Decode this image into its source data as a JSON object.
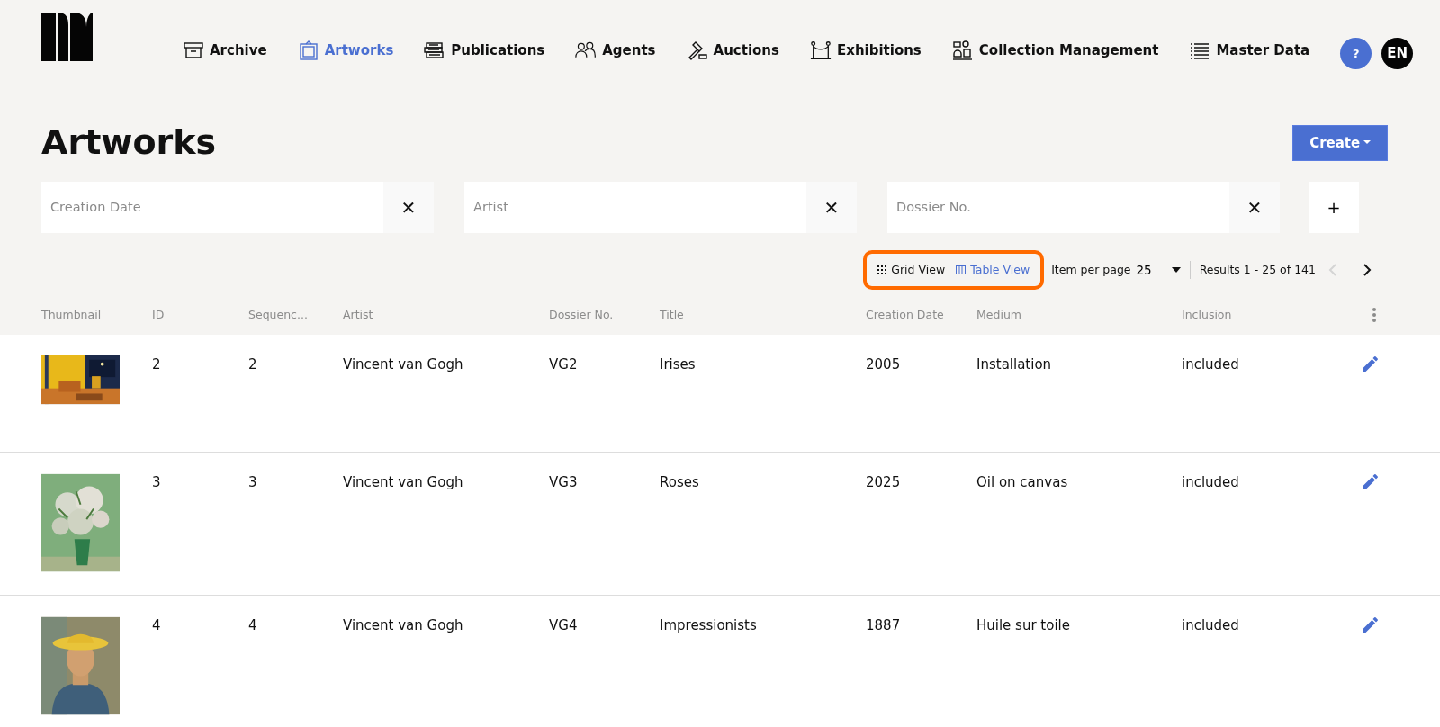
{
  "nav": {
    "items": [
      {
        "label": "Archive",
        "selected": false
      },
      {
        "label": "Artworks",
        "selected": true
      },
      {
        "label": "Publications",
        "selected": false
      },
      {
        "label": "Agents",
        "selected": false
      },
      {
        "label": "Auctions",
        "selected": false
      },
      {
        "label": "Exhibitions",
        "selected": false
      },
      {
        "label": "Collection Management",
        "selected": false
      },
      {
        "label": "Master Data",
        "selected": false
      }
    ],
    "help": "?",
    "language": "EN"
  },
  "page": {
    "title": "Artworks",
    "create_button": "Create"
  },
  "filters": [
    {
      "placeholder": "Creation Date",
      "clear": "✕"
    },
    {
      "placeholder": "Artist",
      "clear": "✕"
    },
    {
      "placeholder": "Dossier No.",
      "clear": "✕"
    }
  ],
  "add_filter": "+",
  "toolbar": {
    "highlighted": true,
    "views": [
      {
        "label": "Grid View",
        "selected": false
      },
      {
        "label": "Table View",
        "selected": true
      }
    ],
    "per_page_label": "Item per page",
    "per_page_value": "25",
    "results": "Results 1 - 25 of 141",
    "prev_disabled": true,
    "next_disabled": false
  },
  "table": {
    "columns": [
      "Thumbnail",
      "ID",
      "Sequenc...",
      "Artist",
      "Dossier No.",
      "Title",
      "Creation Date",
      "Medium",
      "Inclusion"
    ],
    "rows": [
      {
        "cells": [
          "",
          "2",
          "2",
          "Vincent van Gogh",
          "VG2",
          "Irises",
          "2005",
          "Installation",
          "included"
        ]
      },
      {
        "cells": [
          "",
          "3",
          "3",
          "Vincent van Gogh",
          "VG3",
          "Roses",
          "2025",
          "Oil on canvas",
          "included"
        ]
      },
      {
        "cells": [
          "",
          "4",
          "4",
          "Vincent van Gogh",
          "VG4",
          "Impressionists",
          "1887",
          "Huile sur toile",
          "included"
        ]
      }
    ]
  }
}
